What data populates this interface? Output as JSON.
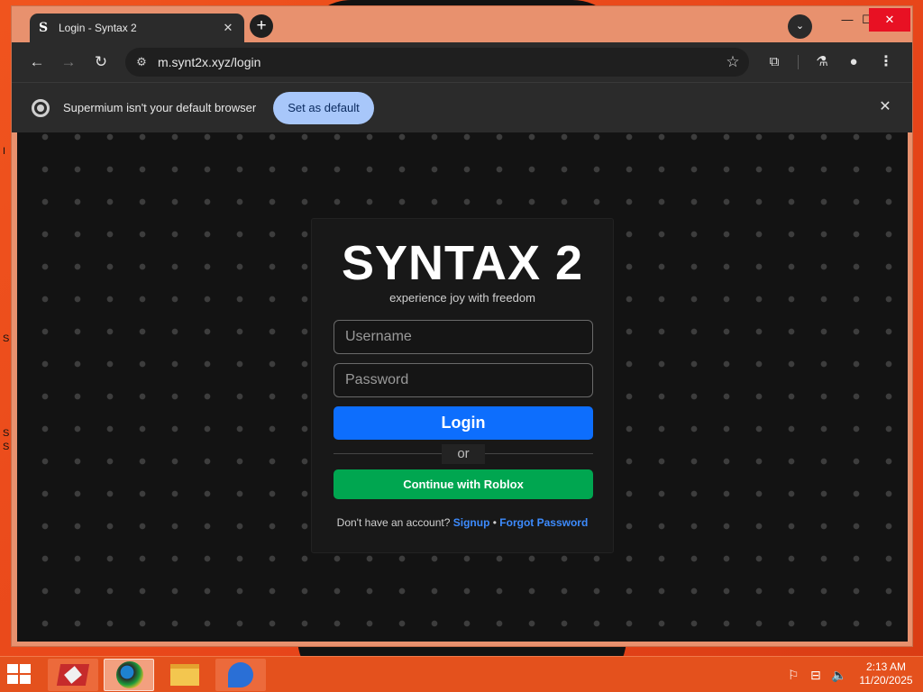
{
  "desktop": {
    "fragments": [
      "I",
      "S",
      "S",
      "S"
    ]
  },
  "browser": {
    "tab": {
      "favicon": "S",
      "title": "Login - Syntax 2",
      "close": "✕"
    },
    "new_tab": "+",
    "tab_search": "⌄",
    "window_controls": {
      "minimize": "—",
      "maximize": "☐",
      "close": "✕"
    },
    "nav": {
      "back": "←",
      "forward": "→",
      "reload": "↻"
    },
    "address": {
      "url": "m.synt2x.xyz/login",
      "site_info_icon": "⚙",
      "bookmark_icon": "☆"
    },
    "toolbar_icons": {
      "extensions": "⧉",
      "labs": "⚗",
      "profile": "●",
      "menu": "⋮"
    },
    "infobar": {
      "message": "Supermium isn't your default browser",
      "button": "Set as default",
      "close": "✕"
    }
  },
  "login": {
    "brand": "SYNTAX 2",
    "tagline": "experience joy with freedom",
    "username_placeholder": "Username",
    "password_placeholder": "Password",
    "login_button": "Login",
    "or": "or",
    "roblox_button": "Continue with Roblox",
    "footer": {
      "prompt": "Don't have an account?",
      "signup": "Signup",
      "separator": "•",
      "forgot": "Forgot Password"
    },
    "colors": {
      "primary": "#0d6efd",
      "roblox": "#00a650",
      "link": "#3d8bfd"
    }
  },
  "taskbar": {
    "apps": [
      "app-red-icon",
      "browser-globe-icon",
      "file-explorer-icon",
      "app-blue-swirl-icon"
    ],
    "tray": {
      "flag": "⚐",
      "network": "⊟",
      "volume": "🔈"
    },
    "time": "2:13 AM",
    "date": "11/20/2025"
  }
}
